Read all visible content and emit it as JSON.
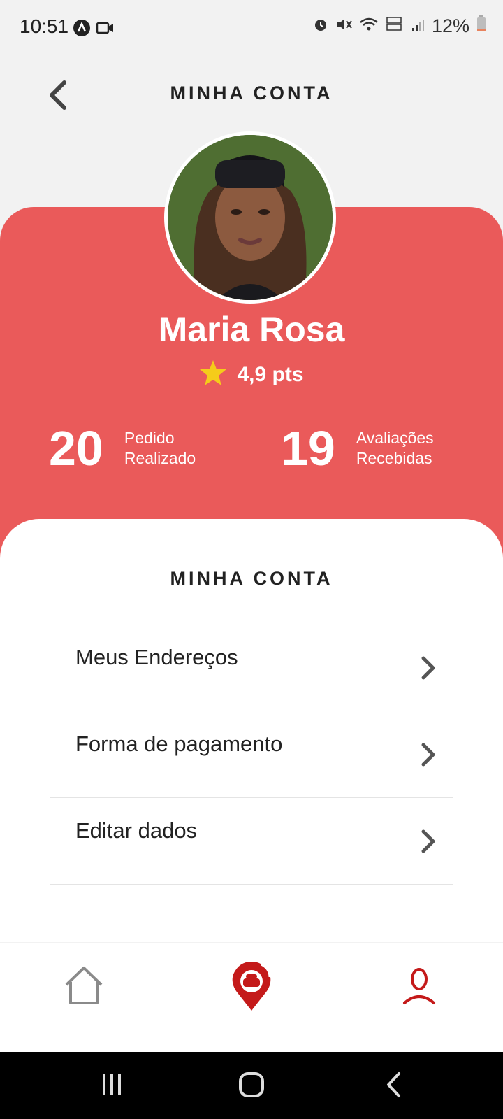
{
  "status_bar": {
    "time": "10:51",
    "battery": "12%",
    "icons": [
      "app-notification-icon",
      "video-icon",
      "alarm-icon",
      "mute-icon",
      "wifi-icon",
      "volte-icon",
      "signal-icon",
      "battery-icon"
    ]
  },
  "header": {
    "title": "MINHA CONTA",
    "back_icon": "chevron-left-icon"
  },
  "profile": {
    "name": "Maria Rosa",
    "rating": "4,9 pts",
    "stats": [
      {
        "value": "20",
        "label_line1": "Pedido",
        "label_line2": "Realizado"
      },
      {
        "value": "19",
        "label_line1": "Avaliações",
        "label_line2": "Recebidas"
      }
    ]
  },
  "account": {
    "title": "MINHA CONTA",
    "items": [
      {
        "label": "Meus Endereços"
      },
      {
        "label": "Forma de pagamento"
      },
      {
        "label": "Editar dados"
      }
    ]
  },
  "bottom_nav": {
    "items": [
      "home-icon",
      "delivery-location-icon",
      "profile-icon"
    ],
    "active": "profile-icon"
  },
  "colors": {
    "accent_red": "#ea5a5a",
    "nav_active": "#c41a1a",
    "star": "#f5cc1a"
  }
}
